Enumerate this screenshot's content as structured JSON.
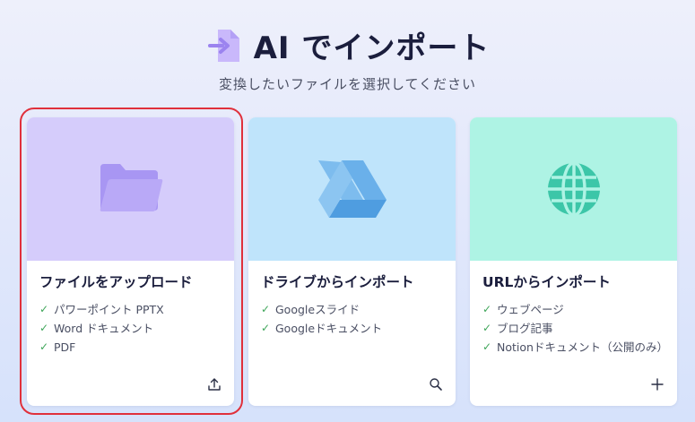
{
  "header": {
    "title": "AI でインポート",
    "subtitle": "変換したいファイルを選択してください",
    "icon": "file-import-icon"
  },
  "cards": [
    {
      "title": "ファイルをアップロード",
      "icon": "folder-icon",
      "action_icon": "upload-icon",
      "art_color": "#d5ccfb",
      "features": [
        "パワーポイント PPTX",
        "Word ドキュメント",
        "PDF"
      ]
    },
    {
      "title": "ドライブからインポート",
      "icon": "google-drive-icon",
      "action_icon": "search-icon",
      "art_color": "#bfe4fb",
      "features": [
        "Googleスライド",
        "Googleドキュメント"
      ]
    },
    {
      "title": "URLからインポート",
      "icon": "globe-icon",
      "action_icon": "plus-icon",
      "art_color": "#aef3e4",
      "features": [
        "ウェブページ",
        "ブログ記事",
        "Notionドキュメント（公開のみ）"
      ]
    }
  ],
  "colors": {
    "highlight": "#e0303b",
    "check": "#3fa65a"
  }
}
